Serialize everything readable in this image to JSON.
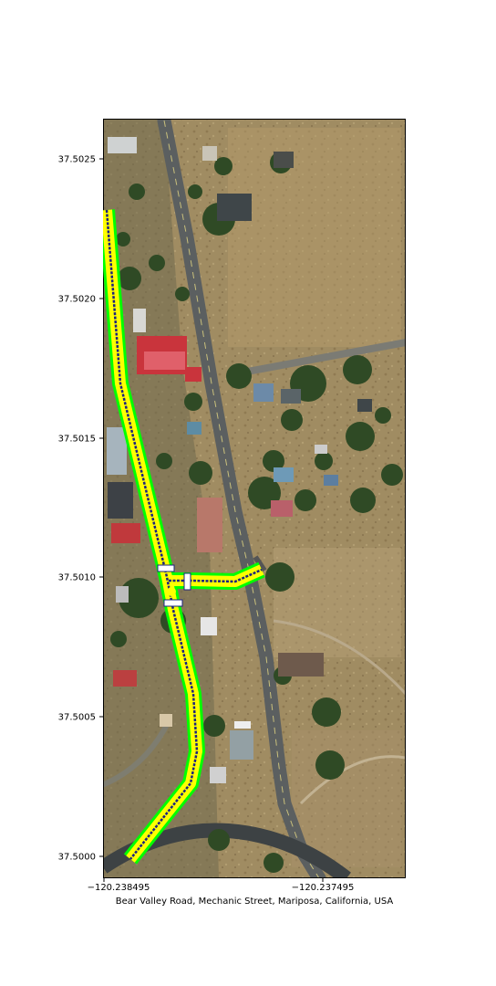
{
  "map": {
    "caption": "Bear Valley Road, Mechanic Street, Mariposa, California, USA",
    "y_ticks": [
      "37.5025",
      "37.5020",
      "37.5015",
      "37.5010",
      "37.5005",
      "37.5000"
    ],
    "x_ticks": [
      "−120.238495",
      "−120.237495"
    ],
    "route_colors": {
      "outer": "#00ff00",
      "inner": "#ffff00",
      "centerline": "#1a237e",
      "stop_marker": "#ffffff"
    }
  }
}
